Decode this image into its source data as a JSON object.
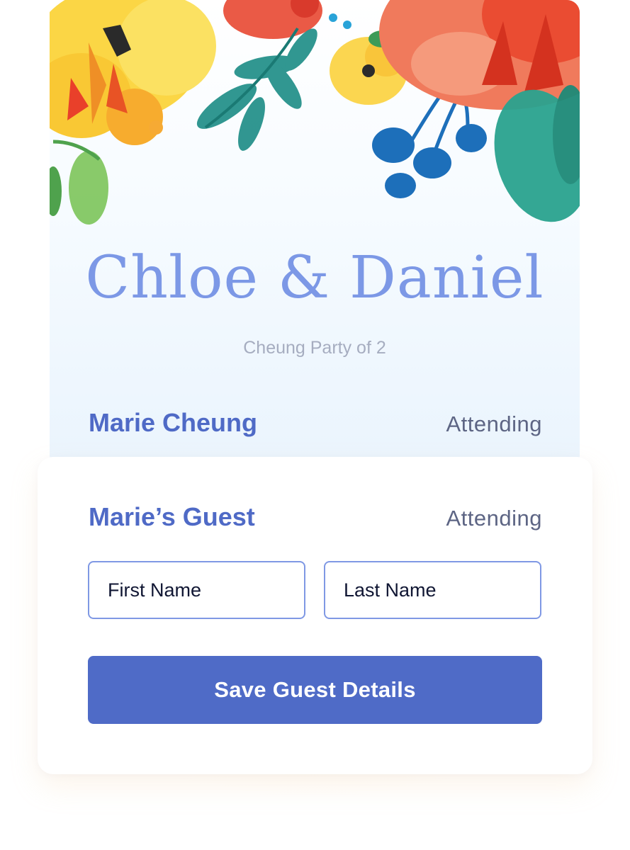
{
  "invitation": {
    "couple_names": "Chloe & Daniel",
    "party_label": "Cheung Party of 2"
  },
  "guests": [
    {
      "name": "Marie Cheung",
      "status": "Attending"
    },
    {
      "name": "Marie’s Guest",
      "status": "Attending"
    }
  ],
  "guest_form": {
    "first_name_placeholder": "First Name",
    "last_name_placeholder": "Last Name",
    "save_label": "Save Guest Details"
  },
  "colors": {
    "accent": "#4f6bc7",
    "names_script": "#7c98e6",
    "field_border": "#7f98e4",
    "muted_text": "#a6adc0"
  },
  "icons": [
    "watercolor-floral-illustration"
  ]
}
